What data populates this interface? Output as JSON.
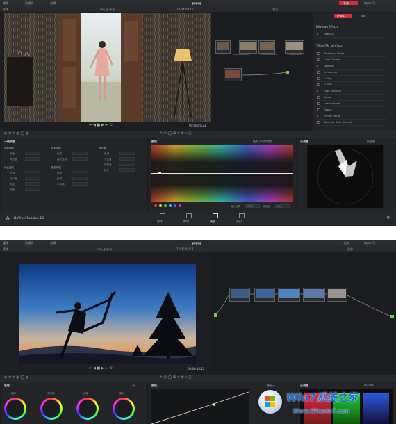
{
  "shot1": {
    "menu_left": [
      "媒体",
      "剪辑页"
    ],
    "menu_edit": "剪辑",
    "project_title": "gugup",
    "menu_right": [
      "节点",
      "OpenFX"
    ],
    "clip_name": "red_gugup",
    "record_timecode": "14:04:08:10",
    "viewer_timecode": "00:00:07:21",
    "mode_label": "节点",
    "luts": {
      "tabs": [
        "资源库",
        "设置"
      ],
      "section1": "BilVision Effects",
      "section1_items": [
        "Defocus"
      ],
      "section2": "Tiffen Dfx rel Color",
      "section2_items": [
        "Black and White",
        "Color Correct",
        "Develop",
        "Enhancing",
        "F-Stop",
        "FL-B/D",
        "High Contrast",
        "Kahlo",
        "Low Contrast",
        "Ozone",
        "Printer Points",
        "Saturate Color Correct"
      ]
    },
    "primaries": {
      "title": "一级校色",
      "groups": [
        {
          "heading": "亮度调整",
          "rows": [
            "亮度",
            "对比度"
          ]
        },
        {
          "heading": "对比曲线",
          "rows": [
            "色调",
            "饱和度",
            "亮度",
            "明暗"
          ]
        },
        {
          "heading": "色彩调整",
          "rows": [
            "色温",
            "高光复原"
          ]
        },
        {
          "heading": "色彩增强",
          "rows": [
            "色度",
            "色调",
            "中间调"
          ]
        },
        {
          "heading": "对比度",
          "rows": [
            "色调",
            "对比度",
            "饱和度",
            "锐化"
          ]
        }
      ]
    },
    "curves": {
      "title": "曲线",
      "mode_label": "色相 vs 饱和度",
      "input_label": "输入色调",
      "input_value": "209.20",
      "output_label": "饱和度",
      "output_value": "1.00"
    },
    "scopes": {
      "title": "示波器",
      "mode_label": "矢量图"
    },
    "brand": "DaVinci Resolve 12",
    "page_tabs": [
      "媒体",
      "剪辑",
      "调色",
      "交付"
    ]
  },
  "shot2": {
    "menu_left": [
      "媒体",
      "剪辑页"
    ],
    "menu_edit": "剪辑",
    "project_title": "gugup",
    "menu_right": [
      "节点",
      "OpenFX"
    ],
    "clip_name": "red_gugup",
    "record_timecode": "17:05:05:13",
    "viewer_timecode": "00:00:13:13",
    "mode_label": "调节",
    "bottom_labels": [
      "色轮",
      "曲线",
      "示波器"
    ],
    "log_label": "Log",
    "parade_label": "Parade",
    "mode2_label": "源显示",
    "wheels": [
      "偏移",
      "中间调",
      "亮部",
      "高光"
    ]
  },
  "colors": {
    "accent_red": "#c8323c",
    "app_bg": "#1d1e21",
    "node_link": "#7ecb3c"
  },
  "watermark": {
    "site": "Win7系统之家",
    "url": "Www.Winwin7.com"
  }
}
